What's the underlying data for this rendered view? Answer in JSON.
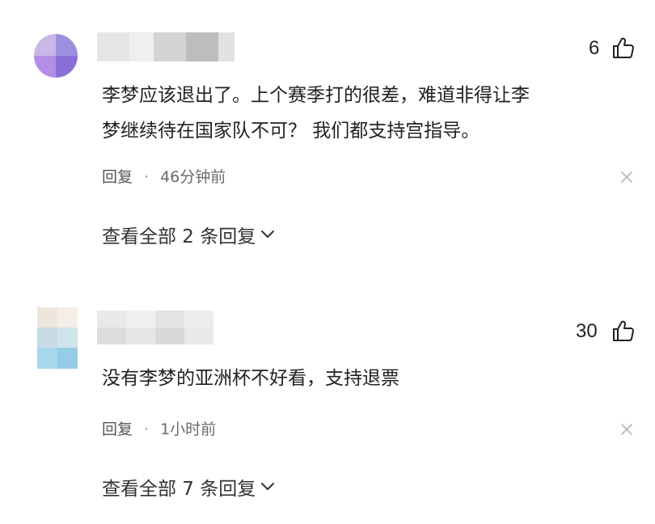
{
  "comments": [
    {
      "likes": "6",
      "text_line1": "李梦应该退出了。上个赛季打的很差，难道非得让李",
      "text_line2": "梦继续待在国家队不可？ 我们都支持宫指导。",
      "reply_label": "回复",
      "time": "46分钟前",
      "view_all": "查看全部 2 条回复"
    },
    {
      "likes": "30",
      "text_line1": "没有李梦的亚洲杯不好看，支持退票",
      "reply_label": "回复",
      "time": "1小时前",
      "view_all": "查看全部 7 条回复"
    }
  ],
  "icons": {
    "like": "thumbs-up-icon",
    "close": "close-icon",
    "expand": "chevron-down-icon"
  }
}
